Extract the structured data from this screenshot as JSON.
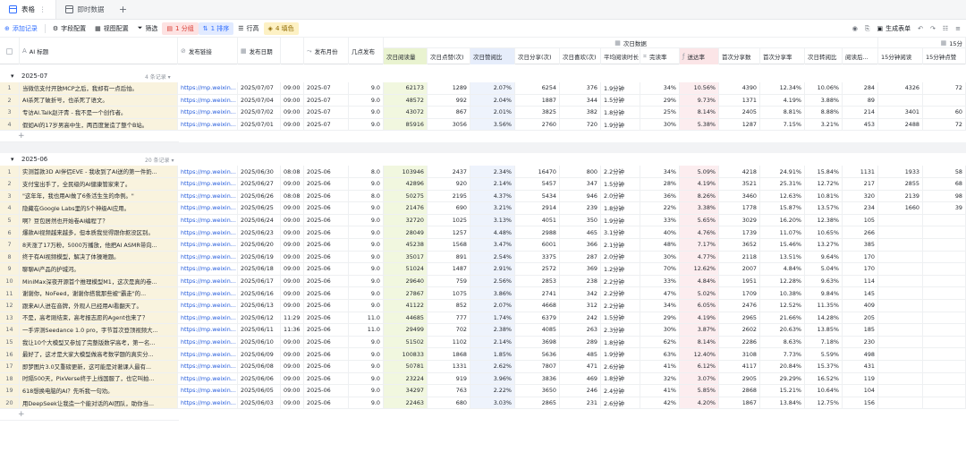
{
  "tabs": [
    {
      "label": "表格",
      "icon": "table-icon",
      "active": true
    },
    {
      "label": "即时数据",
      "icon": "table-icon",
      "active": false
    }
  ],
  "toolbar": {
    "add": "添加记录",
    "fields": "字段配置",
    "views": "视图配置",
    "filter": "筛选",
    "group": "1 分组",
    "sort": "1 排序",
    "rowheight": "行高",
    "fill": "4 填色",
    "generate": "生成表单"
  },
  "headers": {
    "title": "AI 标题",
    "link": "发布链接",
    "date": "发布日期",
    "time": "",
    "month": "发布月份",
    "hour": "几点发布",
    "group_next": "次日数据",
    "group_15": "15分",
    "read": "次日阅读量",
    "like": "次日点赞(次)",
    "likerate": "次日赞阅比",
    "share": "次日分享(次)",
    "fav": "次日喜欢(次)",
    "avgread": "平均阅读时长",
    "finish": "完读率",
    "reach": "送达率",
    "firstshare": "首次分享数",
    "firstsharerate": "首次分享率",
    "forward": "次日转阅比",
    "readafter": "阅读后...",
    "read15": "15分钟阅读",
    "read15b": "15分钟点赞"
  },
  "groups": [
    {
      "name": "2025-07",
      "count": "4 条记录",
      "rows": [
        [
          "1",
          "当微信支付开放MCP之后，我却有一点后怕。",
          "https://mp.weixin...",
          "2025/07/07",
          "09:00",
          "2025-07",
          "9.0",
          "62173",
          "1289",
          "2.07%",
          "6254",
          "376",
          "1.9分钟",
          "34%",
          "10.56%",
          "4390",
          "12.34%",
          "10.06%",
          "284",
          "4326",
          "72"
        ],
        [
          "2",
          "AI杀死了破折号，也杀死了语文。",
          "https://mp.weixin...",
          "2025/07/04",
          "09:00",
          "2025-07",
          "9.0",
          "48572",
          "992",
          "2.04%",
          "1887",
          "344",
          "1.5分钟",
          "29%",
          "9.73%",
          "1371",
          "4.19%",
          "3.88%",
          "89",
          "",
          ""
        ],
        [
          "3",
          "专访AI.Talk赵汗青 - 我不是一个创作者。",
          "https://mp.weixin...",
          "2025/07/02",
          "09:00",
          "2025-07",
          "9.0",
          "43072",
          "867",
          "2.01%",
          "3825",
          "382",
          "1.8分钟",
          "25%",
          "8.14%",
          "2405",
          "8.81%",
          "8.88%",
          "214",
          "3401",
          "60"
        ],
        [
          "4",
          "假如AI的17岁男高中生，两百度复造了整个B站。",
          "https://mp.weixin...",
          "2025/07/01",
          "09:00",
          "2025-07",
          "9.0",
          "85916",
          "3056",
          "3.56%",
          "2760",
          "720",
          "1.9分钟",
          "30%",
          "5.38%",
          "1287",
          "7.15%",
          "3.21%",
          "453",
          "2488",
          "72"
        ]
      ]
    },
    {
      "name": "2025-06",
      "count": "20 条记录",
      "rows": [
        [
          "1",
          "实测首款3D AI伴侣EVE - 我收到了AI送的第一件奶...",
          "https://mp.weixin...",
          "2025/06/30",
          "08:08",
          "2025-06",
          "8.0",
          "103946",
          "2437",
          "2.34%",
          "16470",
          "800",
          "2.2分钟",
          "34%",
          "5.09%",
          "4218",
          "24.91%",
          "15.84%",
          "1131",
          "1933",
          "58"
        ],
        [
          "2",
          "支付宝出手了，全民级的AI健康管家来了。",
          "https://mp.weixin...",
          "2025/06/27",
          "09:00",
          "2025-06",
          "9.0",
          "42896",
          "920",
          "2.14%",
          "5457",
          "347",
          "1.5分钟",
          "28%",
          "4.19%",
          "3521",
          "25.31%",
          "12.72%",
          "217",
          "2855",
          "68"
        ],
        [
          "3",
          "\"这年年，我也用AI做了6条活生生的命例。\"",
          "https://mp.weixin...",
          "2025/06/26",
          "08:08",
          "2025-06",
          "8.0",
          "50275",
          "2195",
          "4.37%",
          "5434",
          "946",
          "2.0分钟",
          "36%",
          "8.26%",
          "3460",
          "12.63%",
          "10.81%",
          "320",
          "2139",
          "98"
        ],
        [
          "4",
          "隐藏在Google Labs里的5个神级AI应用。",
          "https://mp.weixin...",
          "2025/06/25",
          "09:00",
          "2025-06",
          "9.0",
          "21476",
          "690",
          "3.21%",
          "2914",
          "239",
          "1.8分钟",
          "22%",
          "3.38%",
          "1778",
          "15.87%",
          "13.57%",
          "234",
          "1660",
          "39"
        ],
        [
          "5",
          "啊？豆包居然也开始卷AI编程了？",
          "https://mp.weixin...",
          "2025/06/24",
          "09:00",
          "2025-06",
          "9.0",
          "32720",
          "1025",
          "3.13%",
          "4051",
          "350",
          "1.9分钟",
          "33%",
          "5.65%",
          "3029",
          "16.20%",
          "12.38%",
          "105",
          "",
          ""
        ],
        [
          "6",
          "爆款AI视频越来越多，但本质我觉得跟你抠没区别。",
          "https://mp.weixin...",
          "2025/06/23",
          "09:00",
          "2025-06",
          "9.0",
          "28049",
          "1257",
          "4.48%",
          "2988",
          "465",
          "3.1分钟",
          "40%",
          "4.76%",
          "1739",
          "11.07%",
          "10.65%",
          "266",
          "",
          ""
        ],
        [
          "7",
          "8天涨了17万粉，5000万播放，他把AI ASMR带向...",
          "https://mp.weixin...",
          "2025/06/20",
          "09:00",
          "2025-06",
          "9.0",
          "45238",
          "1568",
          "3.47%",
          "6001",
          "366",
          "2.1分钟",
          "48%",
          "7.17%",
          "3652",
          "15.46%",
          "13.27%",
          "385",
          "",
          ""
        ],
        [
          "8",
          "终于有AI视频模型，解决了体操难题。",
          "https://mp.weixin...",
          "2025/06/19",
          "09:00",
          "2025-06",
          "9.0",
          "35017",
          "891",
          "2.54%",
          "3375",
          "287",
          "2.0分钟",
          "30%",
          "4.77%",
          "2118",
          "13.51%",
          "9.64%",
          "170",
          "",
          ""
        ],
        [
          "9",
          "聊聊AI产品的护城河。",
          "https://mp.weixin...",
          "2025/06/18",
          "09:00",
          "2025-06",
          "9.0",
          "51024",
          "1487",
          "2.91%",
          "2572",
          "369",
          "1.2分钟",
          "70%",
          "12.62%",
          "2007",
          "4.84%",
          "5.04%",
          "170",
          "",
          ""
        ],
        [
          "10",
          "MiniMax深夜开源首个推理模型M1，这次是真的卷...",
          "https://mp.weixin...",
          "2025/06/17",
          "09:00",
          "2025-06",
          "9.0",
          "29640",
          "759",
          "2.56%",
          "2853",
          "238",
          "2.2分钟",
          "33%",
          "4.84%",
          "1951",
          "12.28%",
          "9.63%",
          "114",
          "",
          ""
        ],
        [
          "11",
          "谢谢你，NoFeed，谢谢你搭我那些被\"霸走\"的...",
          "https://mp.weixin...",
          "2025/06/16",
          "09:00",
          "2025-06",
          "9.0",
          "27867",
          "1075",
          "3.86%",
          "2741",
          "342",
          "2.2分钟",
          "47%",
          "5.02%",
          "1709",
          "10.38%",
          "9.84%",
          "145",
          "",
          ""
        ],
        [
          "12",
          "跟来AI人进在音牌，外观人已经用AI看翻天了。",
          "https://mp.weixin...",
          "2025/06/13",
          "09:00",
          "2025-06",
          "9.0",
          "41122",
          "852",
          "2.07%",
          "4668",
          "312",
          "2.2分钟",
          "34%",
          "6.05%",
          "2476",
          "12.52%",
          "11.35%",
          "409",
          "",
          ""
        ],
        [
          "13",
          "不是，高考刚结束，高考报志愿的Agent也来了？",
          "https://mp.weixin...",
          "2025/06/12",
          "11:29",
          "2025-06",
          "11.0",
          "44685",
          "777",
          "1.74%",
          "6379",
          "242",
          "1.5分钟",
          "29%",
          "4.19%",
          "2965",
          "21.66%",
          "14.28%",
          "205",
          "",
          ""
        ],
        [
          "14",
          "一手评测Seedance 1.0 pro，字节首次登顶视频大...",
          "https://mp.weixin...",
          "2025/06/11",
          "11:36",
          "2025-06",
          "11.0",
          "29499",
          "702",
          "2.38%",
          "4085",
          "263",
          "2.3分钟",
          "30%",
          "3.87%",
          "2602",
          "20.63%",
          "13.85%",
          "185",
          "",
          ""
        ],
        [
          "15",
          "我让10个大模型又参加了完整版数学高考，第一名...",
          "https://mp.weixin...",
          "2025/06/10",
          "09:00",
          "2025-06",
          "9.0",
          "51502",
          "1102",
          "2.14%",
          "3698",
          "289",
          "1.8分钟",
          "62%",
          "8.14%",
          "2286",
          "8.63%",
          "7.18%",
          "230",
          "",
          ""
        ],
        [
          "16",
          "最好了，这才是大家大模型做高考数学题的真实分...",
          "https://mp.weixin...",
          "2025/06/09",
          "09:00",
          "2025-06",
          "9.0",
          "100833",
          "1868",
          "1.85%",
          "5636",
          "485",
          "1.9分钟",
          "63%",
          "12.40%",
          "3108",
          "7.73%",
          "5.59%",
          "498",
          "",
          ""
        ],
        [
          "17",
          "即梦图片3.0又重磅更新，这可能是对著课人最有...",
          "https://mp.weixin...",
          "2025/06/08",
          "09:00",
          "2025-06",
          "9.0",
          "50781",
          "1331",
          "2.62%",
          "7807",
          "471",
          "2.6分钟",
          "41%",
          "6.12%",
          "4117",
          "20.84%",
          "15.37%",
          "431",
          "",
          ""
        ],
        [
          "18",
          "时隔500天，PixVerse终于上线国服了，也它叫拍...",
          "https://mp.weixin...",
          "2025/06/06",
          "09:00",
          "2025-06",
          "9.0",
          "23224",
          "919",
          "3.96%",
          "3836",
          "469",
          "1.8分钟",
          "32%",
          "3.07%",
          "2905",
          "29.29%",
          "16.52%",
          "119",
          "",
          ""
        ],
        [
          "19",
          "618想换电脑的AI？先听我一句劝。",
          "https://mp.weixin...",
          "2025/06/05",
          "09:00",
          "2025-06",
          "9.0",
          "34297",
          "763",
          "2.22%",
          "3650",
          "246",
          "2.4分钟",
          "41%",
          "5.85%",
          "2868",
          "15.21%",
          "10.64%",
          "104",
          "",
          ""
        ],
        [
          "20",
          "用DeepSeek让我造一个能对话的AI团队，助你当...",
          "https://mp.weixin...",
          "2025/06/03",
          "09:00",
          "2025-06",
          "9.0",
          "22463",
          "680",
          "3.03%",
          "2865",
          "231",
          "2.6分钟",
          "42%",
          "4.20%",
          "1867",
          "13.84%",
          "12.75%",
          "156",
          "",
          ""
        ]
      ]
    }
  ]
}
